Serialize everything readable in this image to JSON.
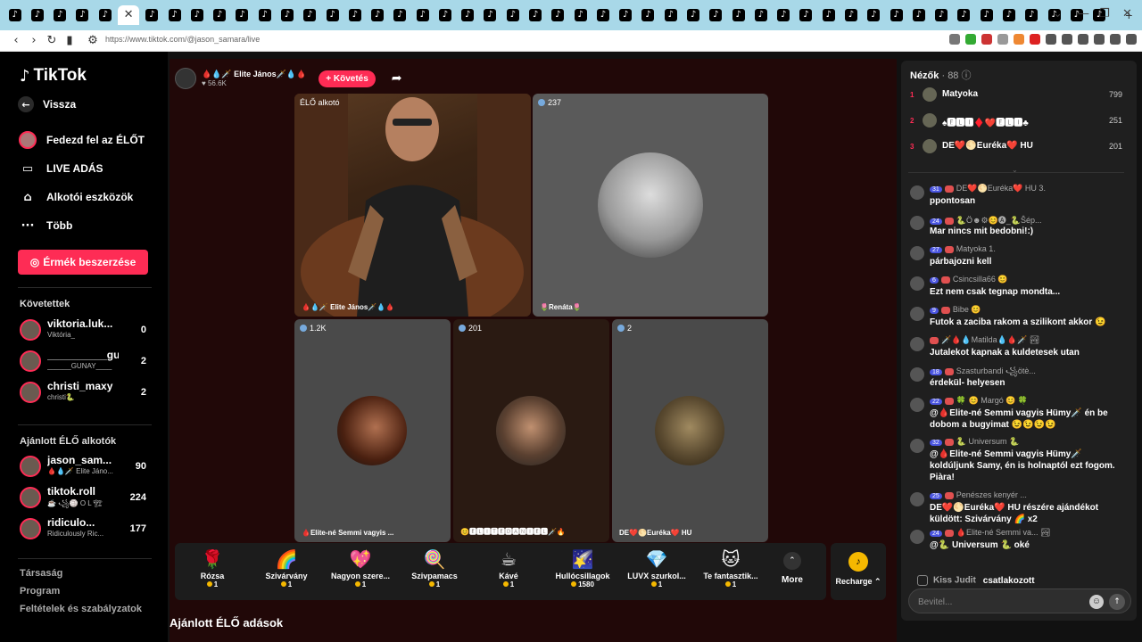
{
  "browser": {
    "url": "https://www.tiktok.com/@jason_samara/live",
    "tab_icon": "♪",
    "close_glyph": "✕",
    "new_tab_glyph": "+",
    "tab_count": 49
  },
  "sidebar": {
    "logo": "TikTok",
    "back": "Vissza",
    "nav": [
      {
        "label": "Fedezd fel az ÉLŐT",
        "icon": "avatar"
      },
      {
        "label": "LIVE ADÁS",
        "icon": "video-icon"
      },
      {
        "label": "Alkotói eszközök",
        "icon": "lightbulb-icon"
      },
      {
        "label": "Több",
        "icon": "more-icon"
      }
    ],
    "coins_button": "Érmék beszerzése",
    "following_title": "Követettek",
    "following": [
      {
        "name": "viktoria.luk...",
        "sub": "Viktória_",
        "count": "0"
      },
      {
        "name": "__________gu...",
        "sub": "______GUNAY____",
        "count": "2"
      },
      {
        "name": "christi_maxy",
        "sub": "christi🐍",
        "count": "2"
      }
    ],
    "recommended_title": "Ajánlott ÉLŐ alkotók",
    "recommended": [
      {
        "name": "jason_sam...",
        "sub": "🩸💧🗡️ Elite Jáno...",
        "count": "90"
      },
      {
        "name": "tiktok.roll",
        "sub": "☕ ꧁🏐 O L 🏗",
        "count": "224"
      },
      {
        "name": "ridiculo...",
        "sub": "Ridiculously Ric...",
        "count": "177"
      }
    ],
    "footer": [
      "Társaság",
      "Program",
      "Feltételek és szabályzatok"
    ]
  },
  "stream": {
    "host_name": "🩸💧🗡️ Elite János🗡️💧🩸",
    "host_likes": "♥ 56.6K",
    "follow_label": "+ Követés",
    "main_label": "ÉLŐ alkotó",
    "main_name": "🩸💧🗡️ Elite János🗡️💧🩸",
    "guests": [
      {
        "count": "237",
        "name": "🌷Renáta🌷"
      },
      {
        "count": "1.2K",
        "name": "🩸Elite-né Semmi vagyis ..."
      },
      {
        "count": "201",
        "name": "😊🅴🅻🅸🆃🅴🅳🅰🅽🅸🅴🅻🗡️🔥"
      },
      {
        "count": "2",
        "name": "DE❤️🌕Euréka❤️ HU"
      }
    ]
  },
  "gifts": [
    {
      "name": "Rózsa",
      "price": "1",
      "icon": "🌹"
    },
    {
      "name": "Szivárvány",
      "price": "1",
      "icon": "🌈"
    },
    {
      "name": "Nagyon szere...",
      "price": "1",
      "icon": "💖"
    },
    {
      "name": "Szivpamacs",
      "price": "1",
      "icon": "🍭"
    },
    {
      "name": "Kávé",
      "price": "1",
      "icon": "☕"
    },
    {
      "name": "Hullócsillagok",
      "price": "1580",
      "icon": "🌠"
    },
    {
      "name": "LUVX szurkol...",
      "price": "1",
      "icon": "💎"
    },
    {
      "name": "Te fantasztik...",
      "price": "1",
      "icon": "🐱"
    }
  ],
  "more_label": "More",
  "recharge_label": "Recharge ⌃",
  "section_title": "Ajánlott ÉLŐ adások",
  "chat": {
    "viewers_label": "Nézők",
    "viewers_count": "· 88",
    "top_viewers": [
      {
        "rank": "1",
        "name": "Matyoka",
        "score": "799"
      },
      {
        "rank": "2",
        "name": "♠🅴🅻🅸♦️❤️🅴🅻🅸♣",
        "score": "251"
      },
      {
        "rank": "3",
        "name": "DE❤️🌕Euréka❤️ HU",
        "score": "201"
      }
    ],
    "messages": [
      {
        "lvl": "31",
        "head": "DE❤️🌕Euréka❤️ HU  3.",
        "text": "ppontosan"
      },
      {
        "lvl": "24",
        "head": "🐍Ö☻⚙😊🅐_🐍Ŝép...",
        "text": "Mar nincs mit bedobni!:)"
      },
      {
        "lvl": "27",
        "head": "Matyoka  1.",
        "text": "párbajozni kell"
      },
      {
        "lvl": "6",
        "head": "Csincsilla66 😊",
        "text": "Ezt nem csak tegnap mondta..."
      },
      {
        "lvl": "9",
        "head": "Bibe 😊",
        "text": "Futok a zaciba rakom a szilikont akkor 😉"
      },
      {
        "lvl": "",
        "head": "🗡️🩸💧Matilda💧🩸🗡️ 🏞",
        "text": "Jutalekot kapnak a kuldetesek utan"
      },
      {
        "lvl": "18",
        "head": "Szasturbandi ꧁ötè...",
        "text": "érdekül- helyesen"
      },
      {
        "lvl": "22",
        "head": "🍀 😊 Margó 😊 🍀",
        "text": "@🩸Elite-né Semmi vagyis Hümy🗡️ én be dobom a bugyimat 😉😉😉😉"
      },
      {
        "lvl": "32",
        "head": "🐍 Universum 🐍",
        "text": "@🩸Elite-né Semmi vagyis Hümy🗡️ koldúljunk Samy, én is holnaptól ezt fogom. Piàra!"
      },
      {
        "lvl": "25",
        "head": "Penészes kenyér ...",
        "text": "DE❤️🌕Euréka❤️ HU részére ajándékot küldött: Szivárvány 🌈 x2"
      },
      {
        "lvl": "24",
        "head": "🩸Elite-né Semmi va...  🏞",
        "text": "@🐍 Universum 🐍 oké"
      }
    ],
    "joined_name": "Kiss Judit",
    "joined_text": "csatlakozott",
    "input_placeholder": "Bevitel..."
  }
}
